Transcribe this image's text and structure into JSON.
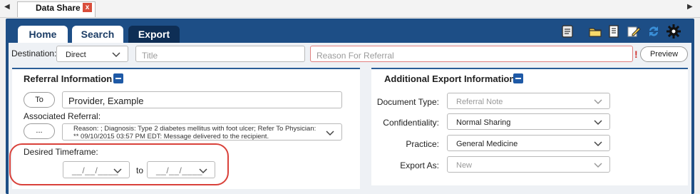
{
  "doc_tab": {
    "label": "Data Share",
    "close_glyph": "x"
  },
  "nav": {
    "tabs": [
      {
        "label": "Home"
      },
      {
        "label": "Search"
      },
      {
        "label": "Export"
      }
    ]
  },
  "toolbar": {
    "icons": [
      "clipboard-icon",
      "folder-icon",
      "document-list-icon",
      "edit-pencil-icon",
      "refresh-icon",
      "gear-icon"
    ]
  },
  "destination": {
    "label": "Destination:",
    "value": "Direct"
  },
  "title_field": {
    "placeholder": "Title"
  },
  "reason_field": {
    "placeholder": "Reason For Referral"
  },
  "required_mark": "!",
  "preview_button": "Preview",
  "referral": {
    "title": "Referral Information",
    "to_button": "To",
    "to_value": "Provider, Example",
    "associated_label": "Associated Referral:",
    "ellipsis_button": "...",
    "associated_line1": "Reason: ; Diagnosis: Type 2 diabetes mellitus with foot ulcer; Refer To Physician:",
    "associated_line2": "** 09/10/2015 03:57 PM EDT: Message delivered to the recipient.",
    "timeframe_label": "Desired Timeframe:",
    "date_from": "__/__/____",
    "to_word": "to",
    "date_to": "__/__/____"
  },
  "export_info": {
    "title": "Additional Export Information",
    "fields": [
      {
        "label": "Document Type:",
        "value": "Referral Note",
        "muted": true
      },
      {
        "label": "Confidentiality:",
        "value": "Normal Sharing",
        "muted": false
      },
      {
        "label": "Practice:",
        "value": "General Medicine",
        "muted": false
      },
      {
        "label": "Export As:",
        "value": "New",
        "muted": true
      }
    ]
  },
  "colors": {
    "app_blue": "#1d4e86",
    "highlight_ring": "#d9413a",
    "required_red": "#d0312d"
  }
}
